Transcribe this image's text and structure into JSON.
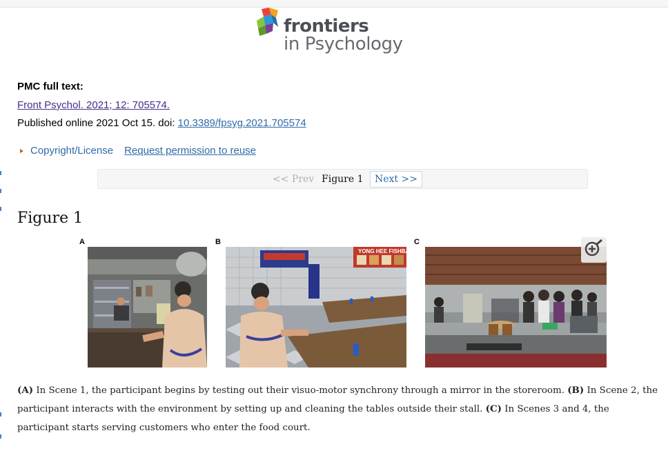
{
  "journal": {
    "logo_line1": "frontiers",
    "logo_line2": "in Psychology"
  },
  "citation": {
    "label": "PMC full text:",
    "link": "Front Psychol. 2021; 12: 705574.",
    "published_prefix": "Published online 2021 Oct 15. doi: ",
    "doi": "10.3389/fpsyg.2021.705574"
  },
  "links": {
    "copyright": "Copyright/License",
    "permission": "Request permission to reuse"
  },
  "nav": {
    "prev": "<< Prev",
    "current": "Figure 1",
    "next": "Next >>"
  },
  "figure": {
    "title": "Figure 1",
    "panels": [
      {
        "letter": "A"
      },
      {
        "letter": "B",
        "sign_text": "YONG HEE FISHBA"
      },
      {
        "letter": "C"
      }
    ],
    "zoom_icon": "zoom-in-icon",
    "caption": {
      "a_label": "(A)",
      "a_text": " In Scene 1, the participant begins by testing out their visuo-motor synchrony through a mirror in the storeroom. ",
      "b_label": "(B)",
      "b_text": " In Scene 2, the participant interacts with the environment by setting up and cleaning the tables outside their stall. ",
      "c_label": "(C)",
      "c_text": " In Scenes 3 and 4, the participant starts serving customers who enter the food court."
    }
  },
  "colors": {
    "link_blue": "#2f6aa8",
    "visited_purple": "#4b2b8c",
    "triangle_orange": "#d2541f"
  }
}
